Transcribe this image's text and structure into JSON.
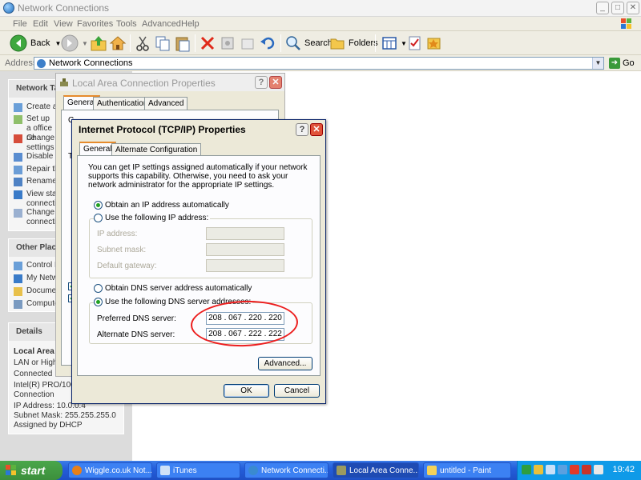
{
  "window": {
    "title": "Network Connections",
    "minimize": "_",
    "maximize": "□",
    "close": "✕"
  },
  "menu": [
    "File",
    "Edit",
    "View",
    "Favorites",
    "Tools",
    "Advanced",
    "Help"
  ],
  "toolbar": {
    "back": "Back",
    "search": "Search",
    "folders": "Folders"
  },
  "address": {
    "label": "Address",
    "value": "Network Connections",
    "go": "Go"
  },
  "taskpane": {
    "network_tasks": {
      "heading": "Network Ta",
      "items": [
        "Create a",
        "Set up a office ne",
        "Change settings",
        "Disable",
        "Repair th",
        "Rename",
        "View sta connectio",
        "Change connectio"
      ]
    },
    "other_places": {
      "heading": "Other Place",
      "items": [
        "Control P",
        "My Netw",
        "Documen",
        "Compute"
      ]
    },
    "details": {
      "heading": "Details",
      "name": "Local Area",
      "lines": [
        "LAN or High-Speed",
        "Connected",
        "Intel(R) PRO/100 V",
        "Connection",
        "IP Address: 10.0.0.4",
        "Subnet Mask: 255.255.255.0",
        "Assigned by DHCP"
      ]
    }
  },
  "lac_dialog": {
    "title": "Local Area Connection Properties",
    "tabs": [
      "General",
      "Authentication",
      "Advanced"
    ],
    "stub_c": "C",
    "stub_t": "T",
    "help": "?",
    "close": "✕"
  },
  "tcp_dialog": {
    "title": "Internet Protocol (TCP/IP) Properties",
    "help": "?",
    "close": "✕",
    "tabs": [
      "General",
      "Alternate Configuration"
    ],
    "intro": "You can get IP settings assigned automatically if your network supports this capability. Otherwise, you need to ask your network administrator for the appropriate IP settings.",
    "obtain_ip": "Obtain an IP address automatically",
    "use_ip": "Use the following IP address:",
    "ip_label": "IP address:",
    "mask_label": "Subnet mask:",
    "gateway_label": "Default gateway:",
    "obtain_dns": "Obtain DNS server address automatically",
    "use_dns": "Use the following DNS server addresses:",
    "preferred_label": "Preferred DNS server:",
    "preferred_value": "208 . 067 . 220 . 220",
    "alternate_label": "Alternate DNS server:",
    "alternate_value": "208 . 067 . 222 . 222",
    "advanced": "Advanced...",
    "ok": "OK",
    "cancel": "Cancel"
  },
  "taskbar": {
    "start": "start",
    "tasks": [
      "Wiggle.co.uk Not...",
      "iTunes",
      "Network Connecti...",
      "Local Area Conne...",
      "untitled - Paint"
    ],
    "clock": "19:42"
  }
}
